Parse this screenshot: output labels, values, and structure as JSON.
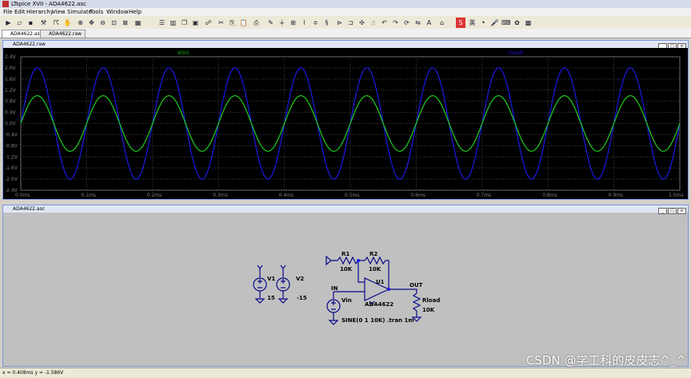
{
  "window": {
    "title": "LTspice XVII - ADA4622.asc"
  },
  "menu": [
    "File",
    "Edit",
    "Hierarchy",
    "View",
    "Simulate",
    "Tools",
    "Window",
    "Help"
  ],
  "tabs": [
    {
      "label": "ADA4622.asc",
      "active": true
    },
    {
      "label": "ADA4622.raw",
      "active": false
    }
  ],
  "waveform_window": {
    "title": "ADA4622.raw",
    "trace_labels": {
      "v_in": "V(in)",
      "v_out": "V(out)"
    },
    "colors": {
      "v_in": "#1fcc1f",
      "v_out": "#1a1ae6",
      "background": "#000000",
      "grid": "#404040",
      "axis_text": "#808080"
    }
  },
  "chart_data": {
    "type": "line",
    "xlim": [
      0,
      1.0
    ],
    "ylim": [
      -2.4,
      2.4
    ],
    "x_ticks": [
      "0.0ms",
      "0.1ms",
      "0.2ms",
      "0.3ms",
      "0.4ms",
      "0.5ms",
      "0.6ms",
      "0.7ms",
      "0.8ms",
      "0.9ms",
      "1.0ms"
    ],
    "y_ticks": [
      "2.4V",
      "2.0V",
      "1.6V",
      "1.2V",
      "0.8V",
      "0.4V",
      "0.0V",
      "-0.4V",
      "-0.8V",
      "-1.2V",
      "-1.6V",
      "-2.0V",
      "-2.4V"
    ],
    "grid": true,
    "series": [
      {
        "name": "V(in)",
        "type": "sine",
        "amplitude": 1.0,
        "offset": 0,
        "frequency_khz": 10,
        "color": "#1fcc1f"
      },
      {
        "name": "V(out)",
        "type": "sine",
        "amplitude": 2.0,
        "offset": 0,
        "frequency_khz": 10,
        "color": "#1a1ae6"
      }
    ]
  },
  "schematic_window": {
    "title": "ADA4622.asc",
    "labels": {
      "r1": "R1",
      "r1_val": "10K",
      "r2": "R2",
      "r2_val": "10K",
      "u1": "U1",
      "u1_part": "ADA4622",
      "v1": "V1",
      "v1_val": "15",
      "v2": "V2",
      "v2_val": "-15",
      "vin": "Vin",
      "vin_val": "SINE(0 1 10K) .tran 1m",
      "in_net": "IN",
      "out_net": "OUT",
      "rload": "Rload",
      "rload_val": "10K"
    },
    "colors": {
      "wire": "#0a0a8a",
      "component": "#0a0a8a",
      "text": "#000000",
      "background": "#c0c0c0",
      "node": "#1a1ae6"
    }
  },
  "status_bar": {
    "text": "x = 0.408ms    y = -1.586V"
  },
  "watermark": "CSDN @学工科的皮皮志^_^"
}
